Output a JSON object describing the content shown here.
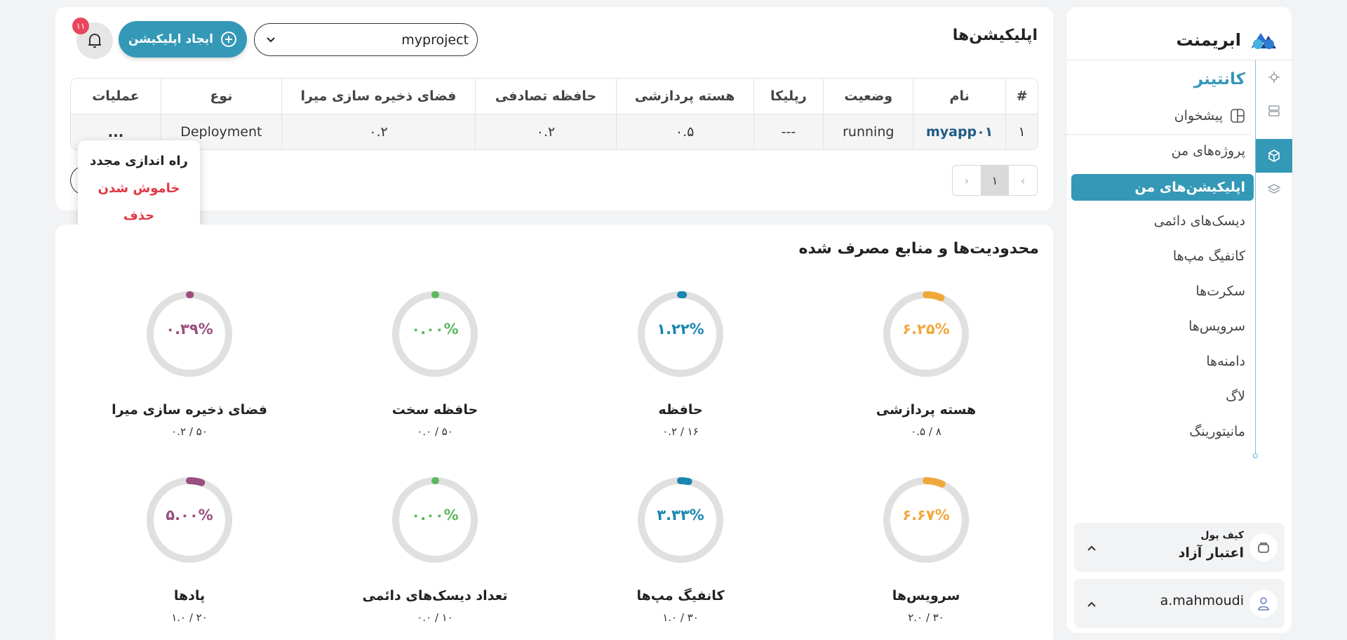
{
  "sidebar": {
    "brand": "ابریمنت",
    "section_title": "کانتینر",
    "items": [
      {
        "label": "پیشخوان"
      },
      {
        "label": "پروژه‌های من"
      },
      {
        "label": "اپلیکیشن‌های من"
      },
      {
        "label": "دیسک‌های دائمی"
      },
      {
        "label": "کانفیگ مپ‌ها"
      },
      {
        "label": "سکرت‌ها"
      },
      {
        "label": "سرویس‌ها"
      },
      {
        "label": "دامنه‌ها"
      },
      {
        "label": "لاگ"
      },
      {
        "label": "مانیتورینگ"
      }
    ],
    "wallet": {
      "title": "کیف پول",
      "value": "اعتبار آزاد"
    },
    "user": {
      "name": "a.mahmoudi"
    }
  },
  "header": {
    "title": "اپلیکیشن‌ها",
    "project": "myproject",
    "create_label": "ایجاد اپلیکیشن",
    "notification_count": "۱۱"
  },
  "table": {
    "columns": [
      "#",
      "نام",
      "وضعیت",
      "رپلیکا",
      "هسته پردازشی",
      "حافظه تصادفی",
      "فضای ذخیره سازی میرا",
      "نوع",
      "عملیات"
    ],
    "rows": [
      {
        "index": "۱",
        "name": "myapp۰۱",
        "status": "running",
        "replica": "---",
        "cpu": "۰.۵",
        "ram": "۰.۲",
        "storage": "۰.۲",
        "type": "Deployment",
        "actions": "..."
      }
    ]
  },
  "pagination": {
    "current": "۱",
    "prev": "‹",
    "next": "›"
  },
  "actions_menu": {
    "restart": "راه اندازی مجدد",
    "shutdown": "خاموش شدن",
    "delete": "حذف"
  },
  "usage": {
    "title": "محدودیت‌ها و منابع مصرف شده",
    "gauges": [
      {
        "label": "هسته پردازشی",
        "percent_text": "۶.۲۵%",
        "usage": "۰.۵ / ۸",
        "percent": 6.25,
        "color": "#f0a83c"
      },
      {
        "label": "حافظه",
        "percent_text": "۱.۲۲%",
        "usage": "۰.۲ / ۱۶",
        "percent": 1.22,
        "color": "#1a86b0"
      },
      {
        "label": "حافظه سخت",
        "percent_text": "۰.۰۰%",
        "usage": "۰.۰ / ۵۰",
        "percent": 0,
        "color": "#5cb85c"
      },
      {
        "label": "فضای ذخیره سازی میرا",
        "percent_text": "۰.۳۹%",
        "usage": "۰.۲ / ۵۰",
        "percent": 0.39,
        "color": "#9a4f7e"
      },
      {
        "label": "سرویس‌ها",
        "percent_text": "۶.۶۷%",
        "usage": "۲.۰ / ۳۰",
        "percent": 6.67,
        "color": "#f0a83c"
      },
      {
        "label": "کانفیگ مپ‌ها",
        "percent_text": "۳.۳۳%",
        "usage": "۱.۰ / ۳۰",
        "percent": 3.33,
        "color": "#1a86b0"
      },
      {
        "label": "تعداد دیسک‌های دائمی",
        "percent_text": "۰.۰۰%",
        "usage": "۰.۰ / ۱۰",
        "percent": 0,
        "color": "#5cb85c"
      },
      {
        "label": "پادها",
        "percent_text": "۵.۰۰%",
        "usage": "۱.۰ / ۲۰",
        "percent": 5,
        "color": "#9a4f7e"
      }
    ]
  }
}
